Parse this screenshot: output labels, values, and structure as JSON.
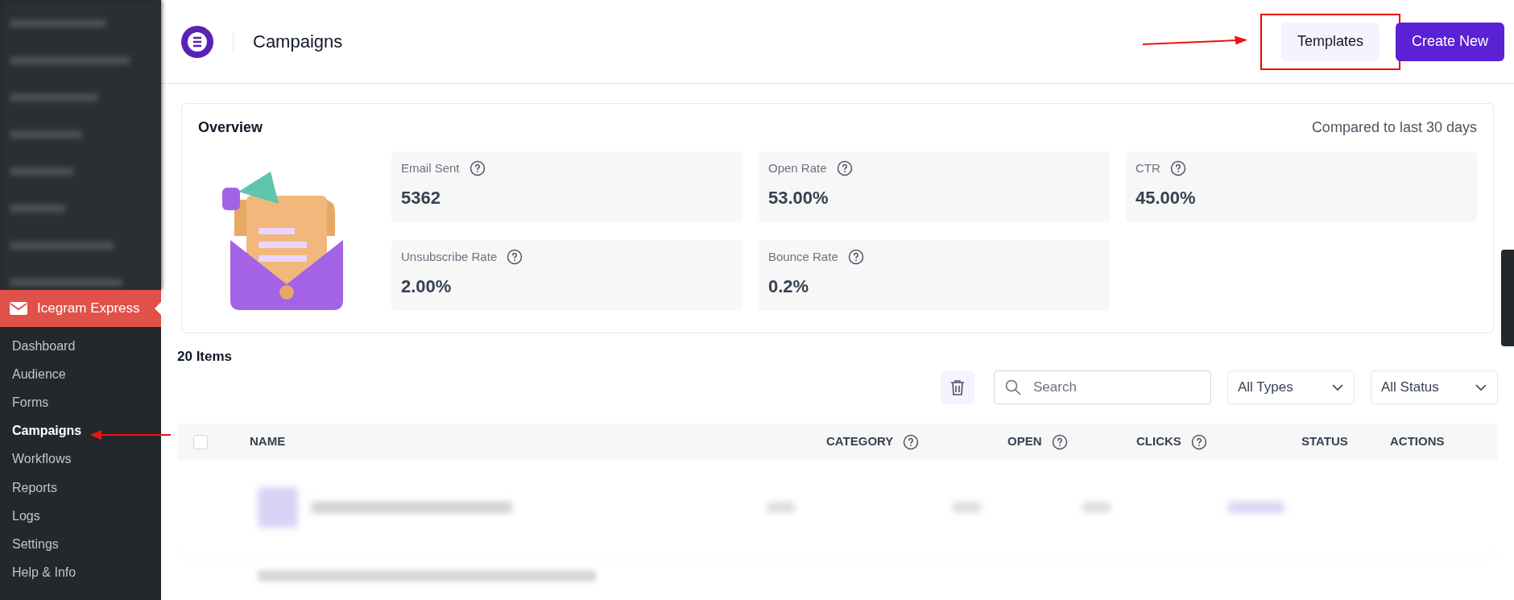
{
  "sidebar": {
    "plugin": {
      "label": "Icegram Express",
      "selected": true
    },
    "items": [
      {
        "label": "Dashboard",
        "selected": false
      },
      {
        "label": "Audience",
        "selected": false
      },
      {
        "label": "Forms",
        "selected": false
      },
      {
        "label": "Campaigns",
        "selected": true
      },
      {
        "label": "Workflows",
        "selected": false
      },
      {
        "label": "Reports",
        "selected": false
      },
      {
        "label": "Logs",
        "selected": false
      },
      {
        "label": "Settings",
        "selected": false
      },
      {
        "label": "Help & Info",
        "selected": false
      }
    ]
  },
  "header": {
    "title": "Campaigns",
    "buttons": [
      {
        "label": "Templates",
        "kind": "secondary"
      },
      {
        "label": "Create New",
        "kind": "primary"
      }
    ]
  },
  "overview": {
    "title": "Overview",
    "period": "Compared to last 30 days",
    "stats": [
      {
        "label": "Email Sent",
        "value": "5362"
      },
      {
        "label": "Open Rate",
        "value": "53.00%"
      },
      {
        "label": "CTR",
        "value": "45.00%"
      },
      {
        "label": "Unsubscribe Rate",
        "value": "2.00%"
      },
      {
        "label": "Bounce Rate",
        "value": "0.2%"
      }
    ]
  },
  "list": {
    "count": "20 Items",
    "search": {
      "placeholder": "Search"
    },
    "filters": [
      "All Types",
      "All Status"
    ],
    "columns": [
      {
        "label": "NAME",
        "help": false
      },
      {
        "label": "CATEGORY",
        "help": true
      },
      {
        "label": "OPEN",
        "help": true
      },
      {
        "label": "CLICKS",
        "help": true
      },
      {
        "label": "STATUS",
        "help": false
      },
      {
        "label": "ACTIONS",
        "help": false
      }
    ],
    "select_all": {
      "checked": false
    }
  }
}
